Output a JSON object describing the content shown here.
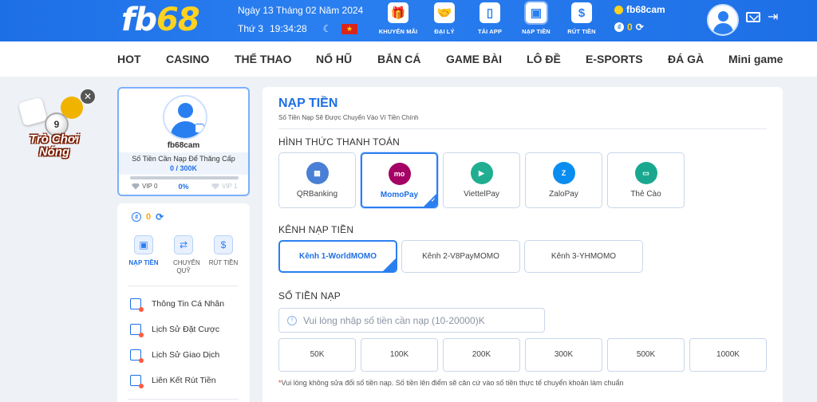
{
  "header": {
    "logo_part1": "fb",
    "logo_part2": "68",
    "date": "Ngày 13 Tháng 02 Năm 2024",
    "weekday": "Thứ 3",
    "time": "19:34:28",
    "nav": [
      {
        "label": "KHUYẾN MÃI",
        "icon": "gift-icon"
      },
      {
        "label": "ĐẠI LÝ",
        "icon": "handshake-icon"
      },
      {
        "label": "TẢI APP",
        "icon": "phone-icon"
      },
      {
        "label": "NẠP TIỀN",
        "icon": "wallet-icon"
      },
      {
        "label": "RÚT TIỀN",
        "icon": "money-bag-icon"
      }
    ],
    "username": "fb68cam",
    "balance": "0"
  },
  "menu": [
    "HOT",
    "CASINO",
    "THỂ THAO",
    "NỔ HŨ",
    "BẮN CÁ",
    "GAME BÀI",
    "LÔ ĐỀ",
    "E-SPORTS",
    "ĐÁ GÀ",
    "Mini game"
  ],
  "hot_badge": {
    "line1": "Trò Chơi",
    "line2": "Nóng",
    "ball_number": "9"
  },
  "profile": {
    "username": "fb68cam",
    "upgrade_label": "Số Tiền Cần Nạp Để Thăng Cấp",
    "upgrade_value": "0 / 300K",
    "progress_fraction": 0,
    "vip_current": "VIP 0",
    "percent": "0%",
    "vip_next": "VIP 1"
  },
  "side": {
    "balance": "0",
    "actions": [
      {
        "label": "NẠP TIỀN",
        "icon": "wallet-icon"
      },
      {
        "label": "CHUYỂN QUỸ",
        "icon": "transfer-icon"
      },
      {
        "label": "RÚT TIỀN",
        "icon": "money-bag-icon"
      }
    ],
    "links": [
      {
        "label": "Thông Tin Cá Nhân",
        "icon": "id-card-icon"
      },
      {
        "label": "Lịch Sử Đặt Cược",
        "icon": "bet-history-icon"
      },
      {
        "label": "Lịch Sử Giao Dịch",
        "icon": "transaction-history-icon"
      },
      {
        "label": "Liên Kết Rút Tiền",
        "icon": "bank-link-icon"
      }
    ]
  },
  "deposit": {
    "title": "NẠP TIỀN",
    "subtitle": "Số Tiền Nạp Sẽ Được Chuyển Vào Ví Tiền Chính",
    "method_heading": "HÌNH THỨC THANH TOÁN",
    "methods": [
      {
        "label": "QRBanking",
        "icon": "qr-icon",
        "color": "#4a7fd6",
        "glyph": "▦"
      },
      {
        "label": "MomoPay",
        "icon": "momo-icon",
        "color": "#a50064",
        "glyph": "mo"
      },
      {
        "label": "ViettelPay",
        "icon": "viettelpay-icon",
        "color": "#1fae8f",
        "glyph": "▶"
      },
      {
        "label": "ZaloPay",
        "icon": "zalopay-icon",
        "color": "#0a8df0",
        "glyph": "Z"
      },
      {
        "label": "Thẻ Cào",
        "icon": "scratch-card-icon",
        "color": "#19a88f",
        "glyph": "▭"
      }
    ],
    "channel_heading": "KÊNH NẠP TIỀN",
    "channels": [
      "Kênh 1-WorldMOMO",
      "Kênh 2-V8PayMOMO",
      "Kênh 3-YHMOMO"
    ],
    "amount_heading": "SỐ TIỀN NẠP",
    "amount_placeholder": "Vui lòng nhập số tiền cần nạp (10-20000)K",
    "amounts": [
      "50K",
      "100K",
      "200K",
      "300K",
      "500K",
      "1000K"
    ],
    "note": "Vui lòng không sửa đổi số tiền nạp. Số tiền lên điểm sẽ căn cứ vào số tiền thực tế chuyển khoản làm chuẩn"
  }
}
